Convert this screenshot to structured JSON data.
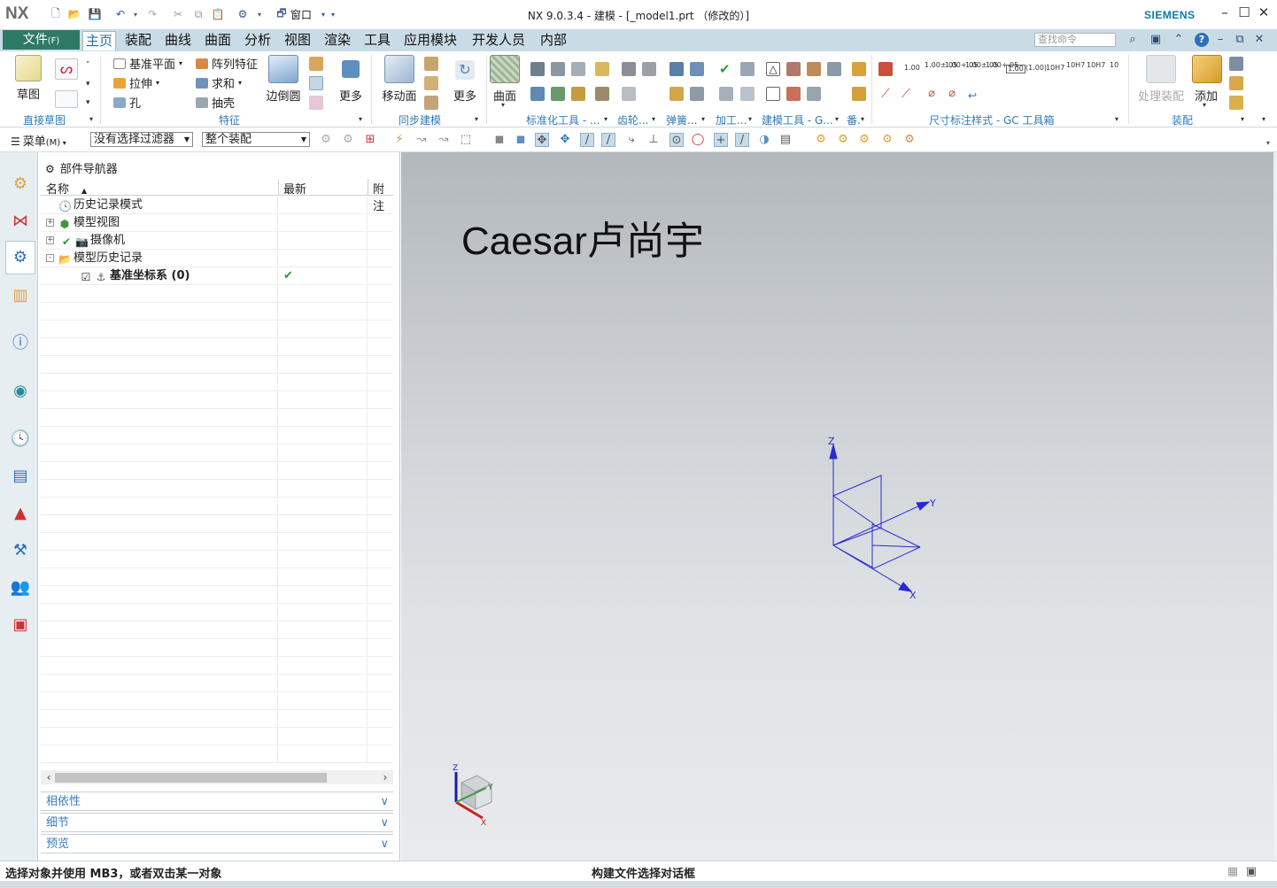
{
  "titlebar": {
    "logo": "NX",
    "window_title": "NX 9.0.3.4 - 建模 - [_model1.prt （修改的）]",
    "brand": "SIEMENS",
    "window_menu": "窗口",
    "min": "–",
    "restore": "☐",
    "close": "✕"
  },
  "menubar": {
    "file": "文件",
    "file_key": "(F)",
    "tabs": [
      "主页",
      "装配",
      "曲线",
      "曲面",
      "分析",
      "视图",
      "渲染",
      "工具",
      "应用模块",
      "开发人员",
      "内部"
    ],
    "active_tab": "主页",
    "search_placeholder": "查找命令"
  },
  "ribbon": {
    "sketch": "草图",
    "direct_sketch_group": "直接草图",
    "feature_items": [
      "基准平面",
      "拉伸",
      "孔",
      "阵列特征",
      "求和",
      "抽壳"
    ],
    "edge_blend": "边倒圆",
    "more": "更多",
    "feature_group": "特征",
    "move_face": "移动面",
    "sync_group": "同步建模",
    "surface": "曲面",
    "std_tools_group": "标准化工具 - ...",
    "gear_group": "齿轮...",
    "spring_group": "弹簧...",
    "machining_group": "加工...",
    "modeling_tools_group": "建模工具 - G...",
    "dim_group": "尺寸标注样式 - GC 工具箱",
    "dim_icons": [
      "1.00",
      "1.00±.05",
      "1.00+.05",
      "1.00±.05",
      "1.00+.05",
      "1.00",
      "(1.00)",
      "10H7",
      "10H7",
      "10H7",
      "10"
    ],
    "dim_icon_label": "10H7",
    "process_assembly": "处理装配",
    "add": "添加",
    "assembly_group": "装配"
  },
  "toolbar2": {
    "menu": "菜单",
    "menu_key": "(M)",
    "filter": "没有选择过滤器",
    "scope": "整个装配"
  },
  "navigator": {
    "title": "部件导航器",
    "columns": [
      "名称",
      "最新",
      "附注"
    ],
    "nodes": [
      {
        "label": "历史记录模式",
        "latest": ""
      },
      {
        "label": "模型视图",
        "latest": ""
      },
      {
        "label": "摄像机",
        "latest": ""
      },
      {
        "label": "模型历史记录",
        "latest": ""
      },
      {
        "label": "基准坐标系 (0)",
        "latest": "✔"
      }
    ],
    "panels": [
      "相依性",
      "细节",
      "预览"
    ]
  },
  "graphics": {
    "watermark": "Caesar卢尚宇",
    "axes": {
      "x": "X",
      "y": "Y",
      "z": "Z"
    },
    "triad_axes": {
      "x": "X",
      "y": "Y",
      "z": "Z"
    }
  },
  "statusbar": {
    "left": "选择对象并使用 MB3，或者双击某一对象",
    "middle": "构建文件选择对话框"
  },
  "colors": {
    "file_menu_bg": "#2f7a66",
    "menubar_bg": "#c9dce6",
    "accent_blue": "#2e7bb8",
    "csys_blue": "#2a2ad0"
  }
}
